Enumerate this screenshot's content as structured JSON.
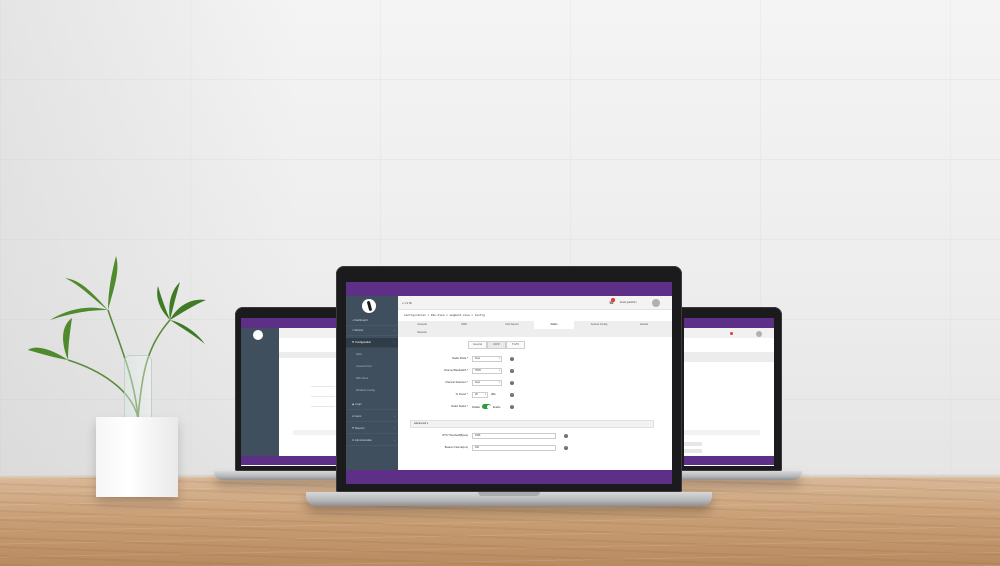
{
  "app": {
    "version": "v-1.3.5b",
    "username": "kevin.pankhim",
    "notification_count": "1",
    "breadcrumb": "Configuration > Pan-Olsa > segment.olsa > Config"
  },
  "sidebar": {
    "items": [
      {
        "label": "Dashboard",
        "icon": "home-icon"
      },
      {
        "label": "Monitor",
        "icon": "monitor-icon"
      },
      {
        "label": "Configuration",
        "icon": "wrench-icon"
      },
      {
        "label": "Sites"
      },
      {
        "label": "Access Point"
      },
      {
        "label": "WiFi Zone"
      },
      {
        "label": "Wireless Config"
      },
      {
        "label": "Login",
        "icon": "login-icon"
      },
      {
        "label": "Users",
        "icon": "users-icon"
      },
      {
        "label": "Reports",
        "icon": "report-icon"
      },
      {
        "label": "Administration",
        "icon": "admin-icon"
      }
    ]
  },
  "tabs": [
    "General",
    "SSID",
    "AAA Server",
    "Radio",
    "Access Config",
    "Guests",
    "Network"
  ],
  "subtabs": [
    "General",
    "2GHz",
    "5 GHz"
  ],
  "form": {
    "radio_mode": {
      "label": "Radio Mode *",
      "value": "11ac"
    },
    "channel_bandwidth": {
      "label": "Channel Bandwidth *",
      "value": "HT20"
    },
    "channel_selection": {
      "label": "Channel Selection *",
      "value": "Auto"
    },
    "tx_power": {
      "label": "Tx Power *",
      "value": "20",
      "suffix": "dBm"
    },
    "radio_status": {
      "label": "Radio Status *",
      "off": "Disable",
      "on": "Enable"
    }
  },
  "advanced": {
    "title": "Advanced ▾",
    "rts_threshold": {
      "label": "RTS Threshold(Bytes)",
      "value": "2346"
    },
    "beacon_interval": {
      "label": "Beacon Interval(ms)",
      "value": "100"
    }
  },
  "colors": {
    "brand_purple": "#5e2f86",
    "sidebar_dark": "#3f4f5d",
    "toggle_green": "#2e9b3a"
  }
}
